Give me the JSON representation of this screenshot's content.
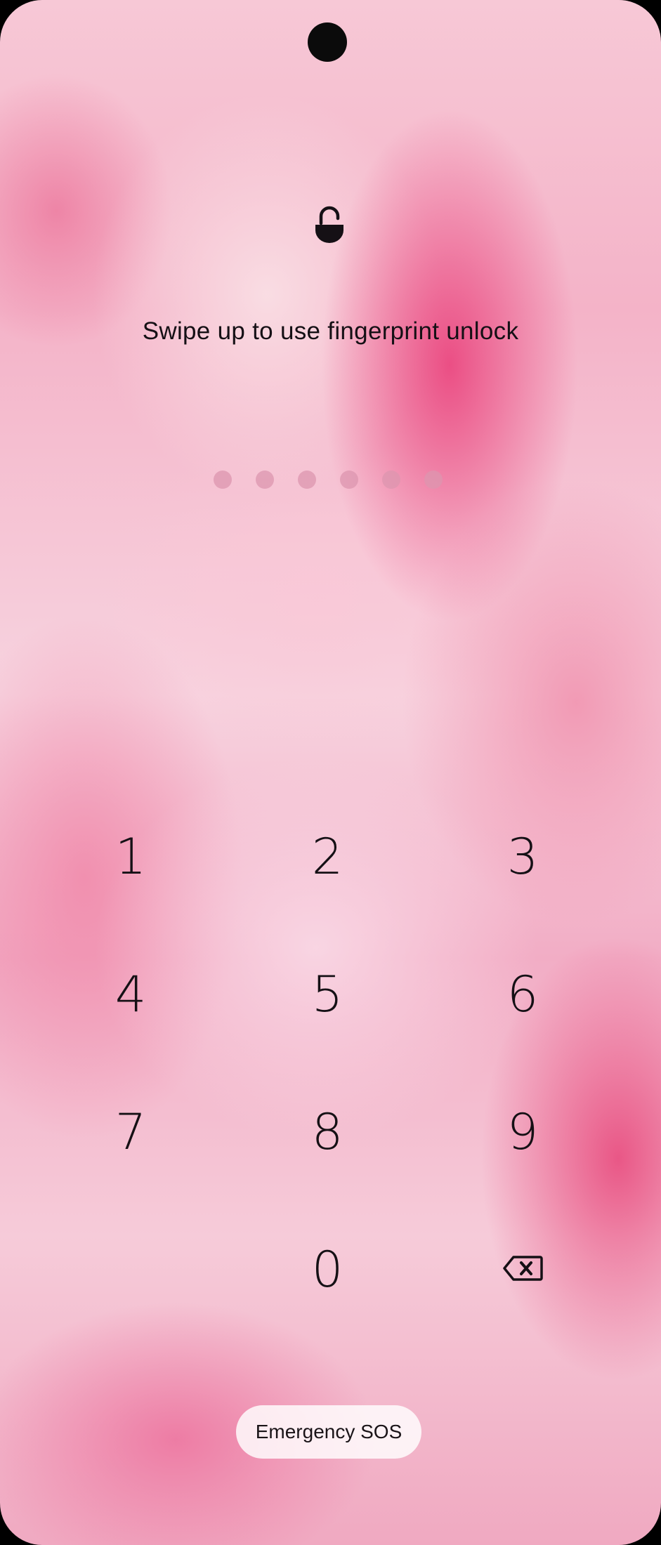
{
  "lockscreen": {
    "hint": "Swipe up to use fingerprint unlock",
    "pin_dot_count": 6
  },
  "keypad": {
    "keys": [
      "1",
      "2",
      "3",
      "4",
      "5",
      "6",
      "7",
      "8",
      "9",
      "0"
    ],
    "backspace_icon": "backspace-icon"
  },
  "emergency": {
    "label": "Emergency SOS"
  },
  "colors": {
    "text": "#151015",
    "accent_pink": "#e93c78"
  }
}
